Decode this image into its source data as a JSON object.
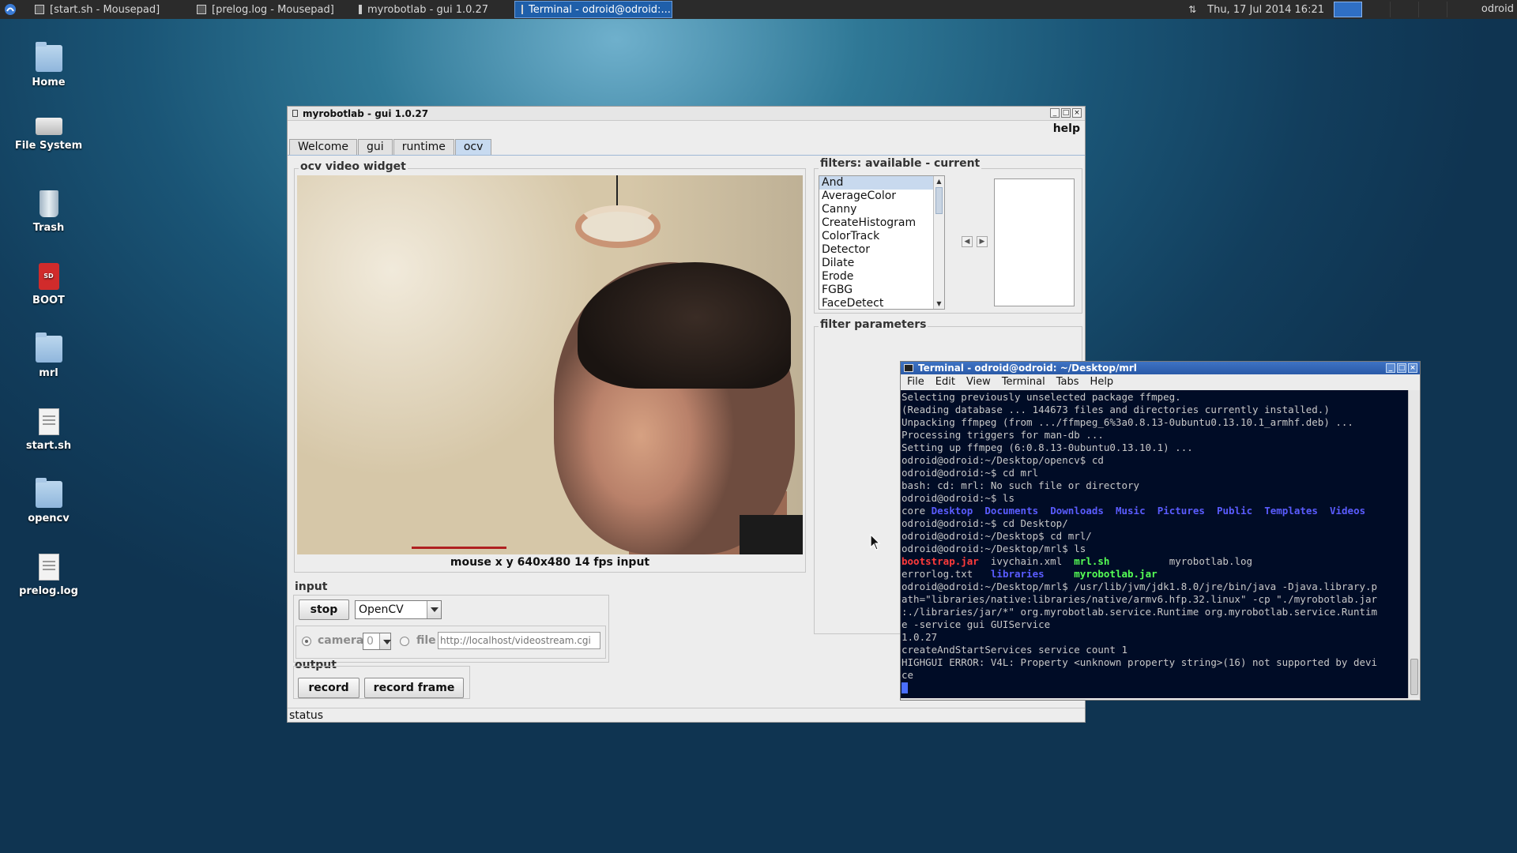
{
  "panel": {
    "tasks": [
      {
        "label": "[start.sh - Mousepad]"
      },
      {
        "label": "[prelog.log - Mousepad]"
      },
      {
        "label": "myrobotlab - gui 1.0.27"
      },
      {
        "label": "Terminal - odroid@odroid:..."
      }
    ],
    "clock": "Thu, 17 Jul 2014 16:21",
    "user": "odroid"
  },
  "desktop": {
    "icons": [
      {
        "label": "Home",
        "icon": "folder-icon"
      },
      {
        "label": "File System",
        "icon": "drive-icon"
      },
      {
        "label": "Trash",
        "icon": "trash-icon"
      },
      {
        "label": "BOOT",
        "icon": "sd-card-icon"
      },
      {
        "label": "mrl",
        "icon": "folder-icon"
      },
      {
        "label": "start.sh",
        "icon": "document-icon"
      },
      {
        "label": "opencv",
        "icon": "folder-icon"
      },
      {
        "label": "prelog.log",
        "icon": "document-icon"
      }
    ]
  },
  "gui": {
    "title": "myrobotlab - gui 1.0.27",
    "menu_help": "help",
    "tabs": [
      "Welcome",
      "gui",
      "runtime",
      "ocv"
    ],
    "video_group": "ocv  video widget",
    "video_status": "mouse x y 640x480 14 fps input",
    "filters_group": "filters: available - current",
    "filters": [
      "And",
      "AverageColor",
      "Canny",
      "CreateHistogram",
      "ColorTrack",
      "Detector",
      "Dilate",
      "Erode",
      "FGBG",
      "FaceDetect"
    ],
    "selected_filter": "And",
    "filter_params_group": "filter parameters",
    "input_group": "input",
    "stop_label": "stop",
    "grabber_value": "OpenCV",
    "camera_label": "camera",
    "camera_index": "0",
    "file_label": "file",
    "file_placeholder": "http://localhost/videostream.cgi",
    "output_group": "output",
    "record_label": "record",
    "record_frame_label": "record frame",
    "status_label": "status"
  },
  "terminal": {
    "title": "Terminal - odroid@odroid: ~/Desktop/mrl",
    "menu": [
      "File",
      "Edit",
      "View",
      "Terminal",
      "Tabs",
      "Help"
    ],
    "lines": [
      "Selecting previously unselected package ffmpeg.",
      "(Reading database ... 144673 files and directories currently installed.)",
      "Unpacking ffmpeg (from .../ffmpeg_6%3a0.8.13-0ubuntu0.13.10.1_armhf.deb) ...",
      "Processing triggers for man-db ...",
      "Setting up ffmpeg (6:0.8.13-0ubuntu0.13.10.1) ...",
      "odroid@odroid:~/Desktop/opencv$ cd",
      "odroid@odroid:~$ cd mrl",
      "bash: cd: mrl: No such file or directory",
      "odroid@odroid:~$ ls"
    ],
    "ls_home": [
      "core",
      "Desktop",
      "Documents",
      "Downloads",
      "Music",
      "Pictures",
      "Public",
      "Templates",
      "Videos"
    ],
    "lines2": [
      "odroid@odroid:~$ cd Desktop/",
      "odroid@odroid:~/Desktop$ cd mrl/",
      "odroid@odroid:~/Desktop/mrl$ ls"
    ],
    "ls_mrl_row1": [
      "bootstrap.jar",
      "ivychain.xml",
      "mrl.sh",
      "myrobotlab.log"
    ],
    "ls_mrl_row2": [
      "errorlog.txt",
      "libraries",
      "myrobotlab.jar"
    ],
    "lines3": [
      "odroid@odroid:~/Desktop/mrl$ /usr/lib/jvm/jdk1.8.0/jre/bin/java -Djava.library.p",
      "ath=\"libraries/native:libraries/native/armv6.hfp.32.linux\" -cp \"./myrobotlab.jar",
      ":./libraries/jar/*\" org.myrobotlab.service.Runtime org.myrobotlab.service.Runtim",
      "e -service gui GUIService",
      "1.0.27",
      "createAndStartServices service count 1",
      "HIGHGUI ERROR: V4L: Property <unknown property string>(16) not supported by devi",
      "ce"
    ]
  }
}
